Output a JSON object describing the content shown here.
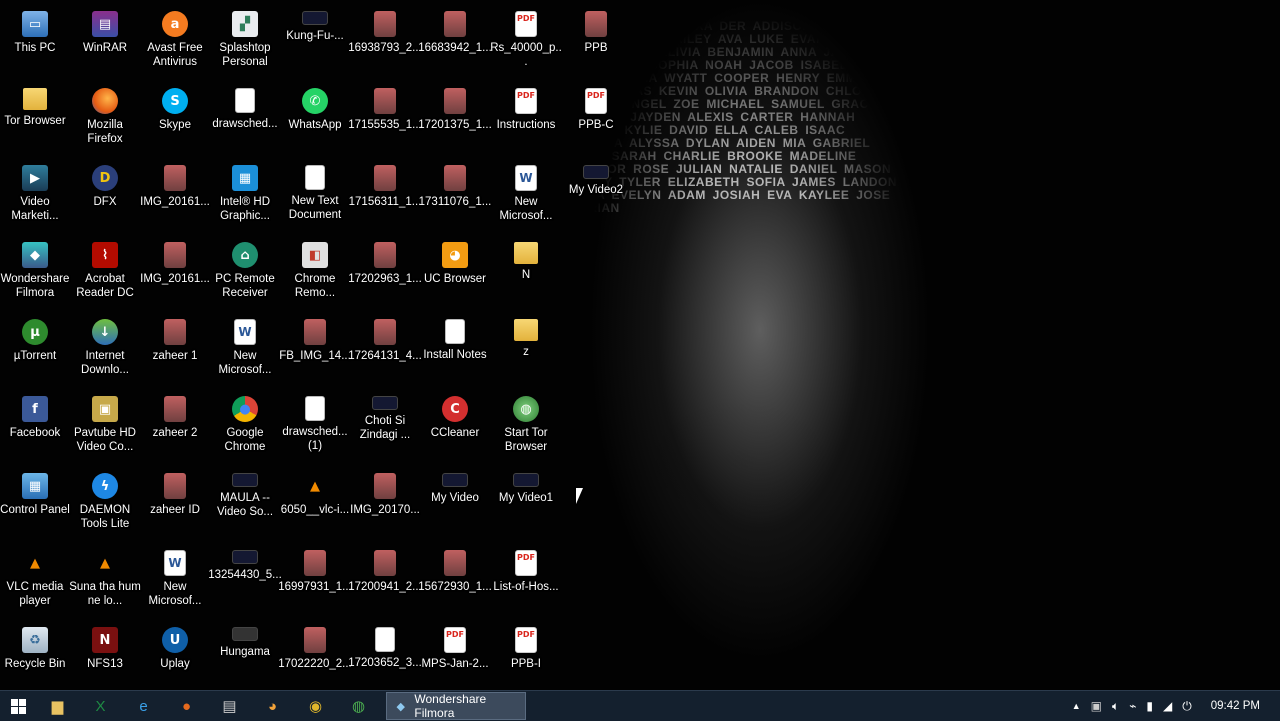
{
  "desktop": {
    "icons": [
      {
        "label": "This PC",
        "icon": "computer-icon"
      },
      {
        "label": "WinRAR",
        "icon": "winrar-icon"
      },
      {
        "label": "Avast Free Antivirus",
        "icon": "avast-icon"
      },
      {
        "label": "Splashtop Personal",
        "icon": "splashtop-icon"
      },
      {
        "label": "Kung-Fu-...",
        "icon": "video-thumbnail-icon"
      },
      {
        "label": "16938793_2...",
        "icon": "image-thumbnail-icon"
      },
      {
        "label": "16683942_1...",
        "icon": "image-thumbnail-icon"
      },
      {
        "label": "Rs_40000_p...",
        "icon": "pdf-icon"
      },
      {
        "label": "PPB",
        "icon": "image-thumbnail-icon"
      },
      {
        "label": "Tor Browser",
        "icon": "tor-browser-icon"
      },
      {
        "label": "Mozilla Firefox",
        "icon": "firefox-icon"
      },
      {
        "label": "Skype",
        "icon": "skype-icon"
      },
      {
        "label": "drawsched...",
        "icon": "document-icon"
      },
      {
        "label": "WhatsApp",
        "icon": "whatsapp-icon"
      },
      {
        "label": "17155535_1...",
        "icon": "image-thumbnail-icon"
      },
      {
        "label": "17201375_1...",
        "icon": "image-thumbnail-icon"
      },
      {
        "label": "Instructions",
        "icon": "pdf-icon"
      },
      {
        "label": "PPB-C",
        "icon": "pdf-icon"
      },
      {
        "label": "Video Marketi...",
        "icon": "video-marketing-icon"
      },
      {
        "label": "DFX",
        "icon": "dfx-icon"
      },
      {
        "label": "IMG_20161...",
        "icon": "image-thumbnail-icon"
      },
      {
        "label": "Intel® HD Graphic...",
        "icon": "intel-graphics-icon"
      },
      {
        "label": "New Text Document",
        "icon": "text-document-icon"
      },
      {
        "label": "17156311_1...",
        "icon": "image-thumbnail-icon"
      },
      {
        "label": "17311076_1...",
        "icon": "image-thumbnail-icon"
      },
      {
        "label": "New Microsof...",
        "icon": "word-document-icon"
      },
      {
        "label": "My Video2",
        "icon": "video-thumbnail-icon"
      },
      {
        "label": "Wondershare Filmora",
        "icon": "filmora-icon"
      },
      {
        "label": "Acrobat Reader DC",
        "icon": "acrobat-icon"
      },
      {
        "label": "IMG_20161...",
        "icon": "image-thumbnail-icon"
      },
      {
        "label": "PC Remote Receiver",
        "icon": "pc-remote-icon"
      },
      {
        "label": "Chrome Remo...",
        "icon": "chrome-remote-icon"
      },
      {
        "label": "17202963_1...",
        "icon": "image-thumbnail-icon"
      },
      {
        "label": "UC Browser",
        "icon": "uc-browser-icon"
      },
      {
        "label": "N",
        "icon": "folder-icon"
      },
      {
        "label": "µTorrent",
        "icon": "utorrent-icon"
      },
      {
        "label": "Internet Downlo...",
        "icon": "idm-icon"
      },
      {
        "label": "zaheer 1",
        "icon": "image-thumbnail-icon"
      },
      {
        "label": "New Microsof...",
        "icon": "word-document-icon"
      },
      {
        "label": "FB_IMG_14...",
        "icon": "image-thumbnail-icon"
      },
      {
        "label": "17264131_4...",
        "icon": "image-thumbnail-icon"
      },
      {
        "label": "Install Notes",
        "icon": "document-icon"
      },
      {
        "label": "z",
        "icon": "folder-icon"
      },
      {
        "label": "Facebook",
        "icon": "facebook-icon"
      },
      {
        "label": "Pavtube HD Video Co...",
        "icon": "pavtube-icon"
      },
      {
        "label": "zaheer 2",
        "icon": "image-thumbnail-icon"
      },
      {
        "label": "Google Chrome",
        "icon": "chrome-icon"
      },
      {
        "label": "drawsched... (1)",
        "icon": "document-icon"
      },
      {
        "label": "Choti Si Zindagi ...",
        "icon": "video-thumbnail-icon"
      },
      {
        "label": "CCleaner",
        "icon": "ccleaner-icon"
      },
      {
        "label": "Start Tor Browser",
        "icon": "tor-globe-icon"
      },
      {
        "label": "Control Panel",
        "icon": "control-panel-icon"
      },
      {
        "label": "DAEMON Tools Lite",
        "icon": "daemon-tools-icon"
      },
      {
        "label": "zaheer ID",
        "icon": "image-thumbnail-icon"
      },
      {
        "label": "MAULA -- Video So...",
        "icon": "video-thumbnail-icon"
      },
      {
        "label": "6050__vlc-i...",
        "icon": "vlc-icon"
      },
      {
        "label": "IMG_20170...",
        "icon": "image-thumbnail-icon"
      },
      {
        "label": "My Video",
        "icon": "video-thumbnail-icon"
      },
      {
        "label": "My Video1",
        "icon": "video-thumbnail-icon"
      },
      {
        "label": "VLC media player",
        "icon": "vlc-icon"
      },
      {
        "label": "Suna tha hum ne lo...",
        "icon": "vlc-icon"
      },
      {
        "label": "New Microsof...",
        "icon": "word-document-icon"
      },
      {
        "label": "13254430_5...",
        "icon": "video-thumbnail-icon"
      },
      {
        "label": "16997931_1...",
        "icon": "image-thumbnail-icon"
      },
      {
        "label": "17200941_2...",
        "icon": "image-thumbnail-icon"
      },
      {
        "label": "15672930_1...",
        "icon": "image-thumbnail-icon"
      },
      {
        "label": "List-of-Hos...",
        "icon": "pdf-icon"
      },
      {
        "label": "Recycle Bin",
        "icon": "recycle-bin-icon"
      },
      {
        "label": "NFS13",
        "icon": "nfs-icon"
      },
      {
        "label": "Uplay",
        "icon": "uplay-icon"
      },
      {
        "label": "Hungama",
        "icon": "hungama-icon"
      },
      {
        "label": "17022220_2...",
        "icon": "image-thumbnail-icon"
      },
      {
        "label": "17203652_3...",
        "icon": "document-icon"
      },
      {
        "label": "MPS-Jan-2...",
        "icon": "pdf-icon"
      },
      {
        "label": "PPB-I",
        "icon": "pdf-icon"
      }
    ]
  },
  "wallpaper": {
    "names": "GINA BRIELLA ALEXA DER ADDISON NATHAN COLE ELIJAH HAILEY AVA LUKE EVAN MATTHEW RILEY EMILY ALIVIA BENJAMIN ANNA JACKSON LILY OWEN SOPHIA NOAH JACOB ISABELLA ETHAN JULIA WYATT COOPER HENRY EMMA LIAM LUCAS KEVIN OLIVIA BRANDON CHLOE LOGAN ANGEL ZOE MICHAEL SAMUEL GRACE AUDREY JAYDEN ALEXIS CARTER HANNAH AUSTIN KYLIE DAVID ELLA CALEB ISAAC JOSHUA ALYSSA DYLAN AIDEN MIA GABRIEL LEAH SARAH CHARLIE BROOKE MADELINE CONNOR ROSE JULIAN NATALIE DANIEL MASON AVERY TYLER ELIZABETH SOFIA JAMES LANDON MAYA EVELYN ADAM JOSIAH EVA KAYLEE JOSE ADRIAN"
  },
  "taskbar": {
    "start_icon": "windows-logo-icon",
    "pinned": [
      {
        "name": "file-explorer-icon",
        "glyph": "▆",
        "color": "#e8c262"
      },
      {
        "name": "excel-icon",
        "glyph": "X",
        "color": "#1e8a44"
      },
      {
        "name": "internet-explorer-icon",
        "glyph": "e",
        "color": "#3aa0e8"
      },
      {
        "name": "firefox-icon",
        "glyph": "●",
        "color": "#e66a1e"
      },
      {
        "name": "printer-icon",
        "glyph": "▤",
        "color": "#cccccc"
      },
      {
        "name": "uc-browser-icon",
        "glyph": "◕",
        "color": "#f3a33a"
      },
      {
        "name": "chrome-icon",
        "glyph": "◉",
        "color": "#e0b82c"
      },
      {
        "name": "tor-globe-icon",
        "glyph": "◍",
        "color": "#4caf50"
      }
    ],
    "active_app": {
      "label": "Wondershare Filmora",
      "icon": "filmora-icon"
    },
    "tray": {
      "show_hidden": "▲",
      "clock": "09:42 PM"
    }
  },
  "colors": {
    "taskbar_bg": "#14202e",
    "active_app_bg": "#3c4a5c",
    "pdf_red": "#d9251c"
  }
}
